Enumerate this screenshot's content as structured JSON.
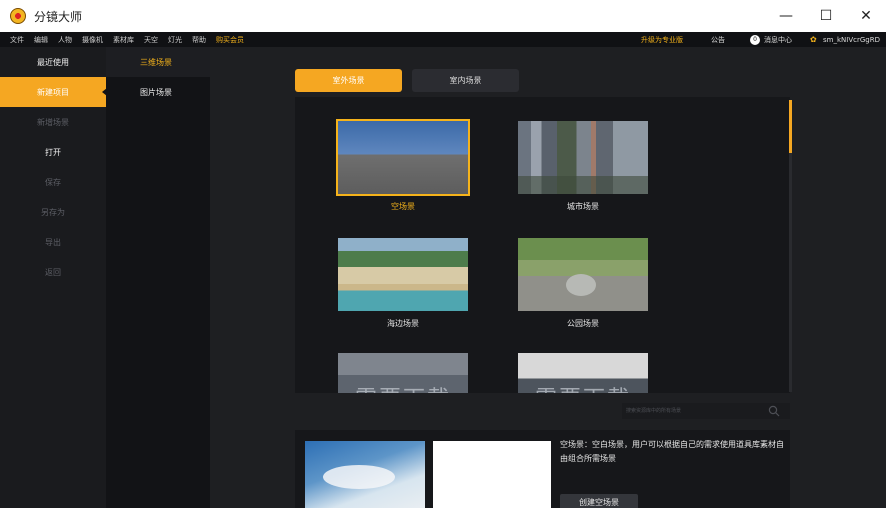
{
  "window": {
    "title": "分镜大师",
    "controls": [
      "—",
      "☐",
      "✕"
    ]
  },
  "menubar": {
    "items": [
      "文件",
      "编辑",
      "人物",
      "摄像机",
      "素材库",
      "天空",
      "灯光",
      "帮助"
    ],
    "vip": "购买会员",
    "upgrade": "升级为专业版",
    "notice": "公告",
    "message_count": "0",
    "message_center": "消息中心",
    "username": "sm_kNIVcrGgRD"
  },
  "sidebar1": {
    "items": [
      {
        "label": "最近使用",
        "state": "normal"
      },
      {
        "label": "新建项目",
        "state": "active"
      },
      {
        "label": "新增场景",
        "state": "dim"
      },
      {
        "label": "打开",
        "state": "normal"
      },
      {
        "label": "保存",
        "state": "dim"
      },
      {
        "label": "另存为",
        "state": "dim"
      },
      {
        "label": "导出",
        "state": "dim"
      },
      {
        "label": "返回",
        "state": "dim"
      }
    ]
  },
  "sidebar2": {
    "items": [
      {
        "label": "三维场景",
        "state": "active"
      },
      {
        "label": "图片场景",
        "state": "normal"
      }
    ]
  },
  "tabs": [
    {
      "label": "室外场景",
      "active": true
    },
    {
      "label": "室内场景",
      "active": false
    }
  ],
  "scenes": [
    {
      "label": "空场景",
      "selected": true
    },
    {
      "label": "城市场景",
      "selected": false
    },
    {
      "label": "海边场景",
      "selected": false
    },
    {
      "label": "公园场景",
      "selected": false
    },
    {
      "label": "",
      "overlay": "需要下载",
      "selected": false
    },
    {
      "label": "",
      "overlay": "需要下载",
      "selected": false
    }
  ],
  "search": {
    "placeholder": "搜索资源库中的所有场景"
  },
  "detail": {
    "description": "空场景：空白场景，用户可以根据自己的需求使用道具库素材自由组合所需场景",
    "create_button": "创建空场景"
  },
  "colors": {
    "accent": "#f5a722",
    "highlight_text": "#f5b31b"
  }
}
